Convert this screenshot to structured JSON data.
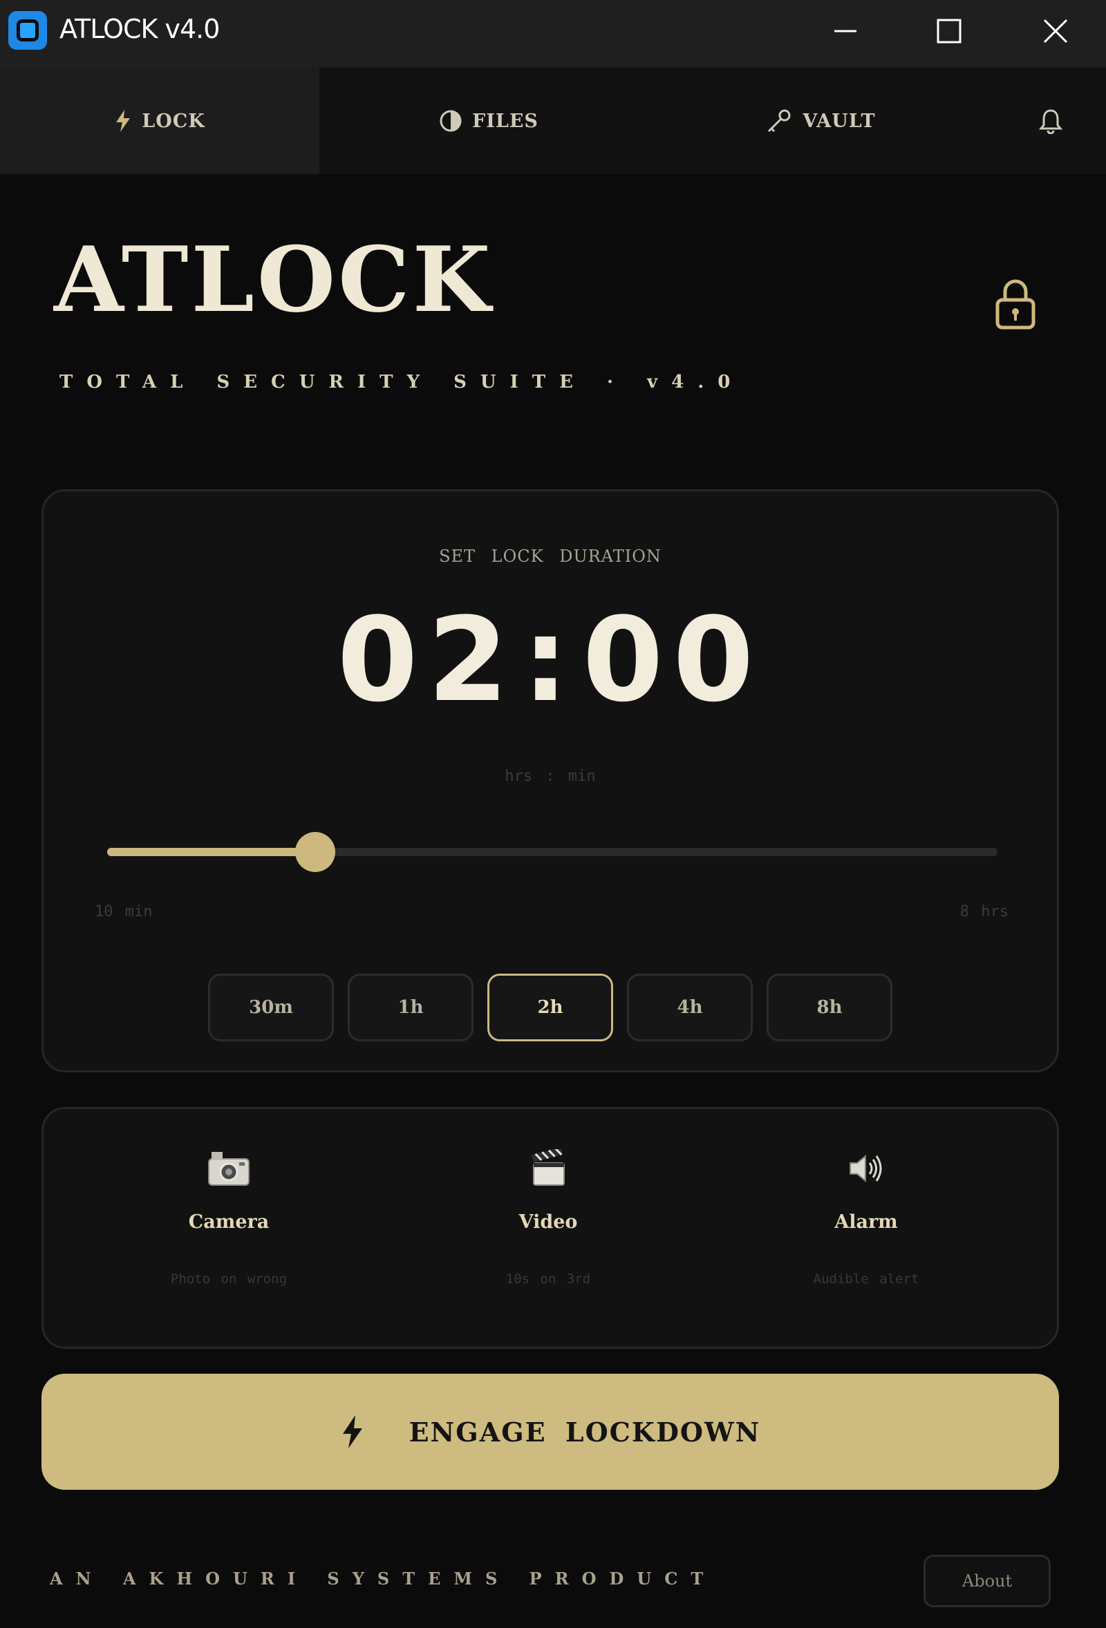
{
  "window": {
    "title": "ATLOCK  v4.0",
    "controls": [
      "minimize",
      "maximize",
      "close"
    ]
  },
  "tabs": [
    {
      "label": "LOCK",
      "icon": "lightning-icon",
      "active": true
    },
    {
      "label": "FILES",
      "icon": "shield-icon",
      "active": false
    },
    {
      "label": "VAULT",
      "icon": "key-icon",
      "active": false
    },
    {
      "label": "",
      "icon": "bell-icon",
      "active": false
    }
  ],
  "header": {
    "brand": "ATLOCK",
    "tagline": "TOTAL SECURITY SUITE · v4.0",
    "icon": "padlock-icon"
  },
  "duration": {
    "label": "SET LOCK DURATION",
    "hours": "02",
    "separator": ":",
    "minutes": "00",
    "unit_label": "hrs : min",
    "slider_fraction": 0.234,
    "range_min": "10 min",
    "range_max": "8 hrs",
    "presets": [
      {
        "label": "30m",
        "active": false
      },
      {
        "label": "1h",
        "active": false
      },
      {
        "label": "2h",
        "active": true
      },
      {
        "label": "4h",
        "active": false
      },
      {
        "label": "8h",
        "active": false
      }
    ]
  },
  "features": [
    {
      "icon": "camera-icon",
      "title": "Camera",
      "desc": "Photo on wrong"
    },
    {
      "icon": "clapperboard-icon",
      "title": "Video",
      "desc": "10s on 3rd"
    },
    {
      "icon": "speaker-icon",
      "title": "Alarm",
      "desc": "Audible alert"
    }
  ],
  "engage": {
    "label": "ENGAGE LOCKDOWN",
    "icon": "lightning-icon"
  },
  "footer": {
    "text": "AN AKHOURI SYSTEMS PRODUCT",
    "about_label": "About"
  },
  "colors": {
    "accent": "#cdb97f",
    "background": "#0b0b0b",
    "card": "#121212",
    "titlebar": "#1f1f1f"
  }
}
